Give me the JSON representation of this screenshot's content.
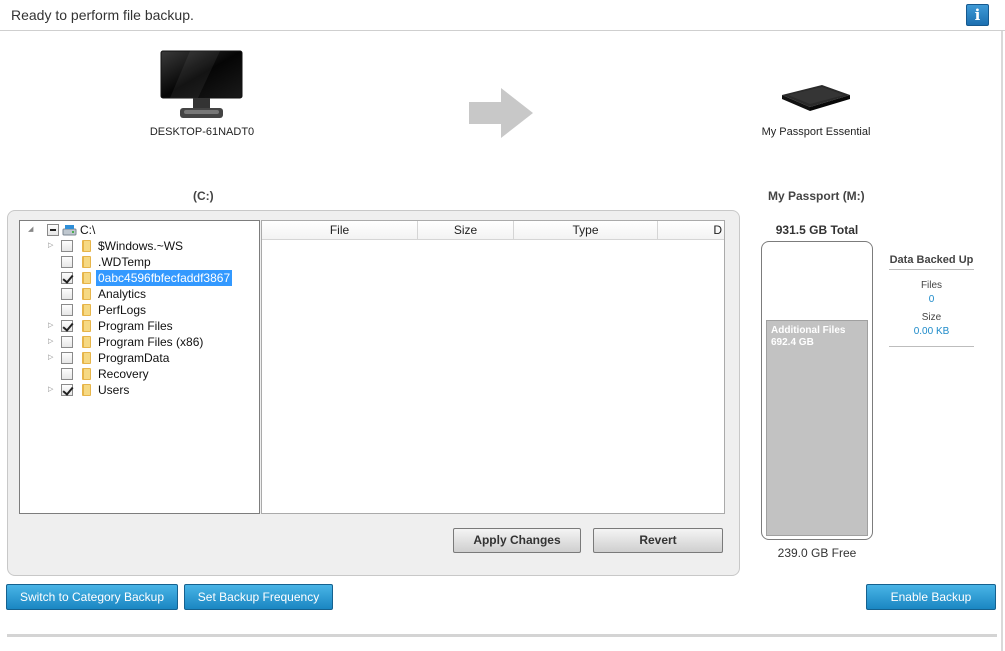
{
  "status": {
    "message": "Ready to perform file backup."
  },
  "source": {
    "computer_name": "DESKTOP-61NADT0",
    "drive_label": "(C:)"
  },
  "destination": {
    "device_name": "My Passport Essential",
    "drive_label": "My Passport (M:)"
  },
  "tree": {
    "root": {
      "label": "C:\\",
      "state": "partial"
    },
    "items": [
      {
        "label": "$Windows.~WS",
        "checked": false,
        "expandable": true,
        "selected": false
      },
      {
        "label": ".WDTemp",
        "checked": false,
        "expandable": false,
        "selected": false
      },
      {
        "label": "0abc4596fbfecfaddf3867",
        "checked": true,
        "expandable": false,
        "selected": true
      },
      {
        "label": "Analytics",
        "checked": false,
        "expandable": false,
        "selected": false
      },
      {
        "label": "PerfLogs",
        "checked": false,
        "expandable": false,
        "selected": false
      },
      {
        "label": "Program Files",
        "checked": true,
        "expandable": true,
        "selected": false
      },
      {
        "label": "Program Files (x86)",
        "checked": false,
        "expandable": true,
        "selected": false
      },
      {
        "label": "ProgramData",
        "checked": false,
        "expandable": true,
        "selected": false
      },
      {
        "label": "Recovery",
        "checked": false,
        "expandable": false,
        "selected": false
      },
      {
        "label": "Users",
        "checked": true,
        "expandable": true,
        "selected": false
      }
    ]
  },
  "file_list": {
    "columns": [
      "File",
      "Size",
      "Type",
      "D"
    ]
  },
  "buttons": {
    "apply": "Apply Changes",
    "revert": "Revert",
    "category_backup": "Switch to Category Backup",
    "backup_frequency": "Set Backup Frequency",
    "enable_backup": "Enable Backup"
  },
  "capacity": {
    "total": "931.5 GB Total",
    "free": "239.0 GB Free",
    "additional_label": "Additional Files",
    "additional_value": "692.4 GB",
    "used_fraction": 0.743
  },
  "backed_up": {
    "title": "Data Backed Up",
    "files_label": "Files",
    "files_value": "0",
    "size_label": "Size",
    "size_value": "0.00 KB"
  },
  "colors": {
    "accent_blue": "#1a86c2",
    "selection": "#3399ff",
    "value_text": "#1d8ac9"
  }
}
